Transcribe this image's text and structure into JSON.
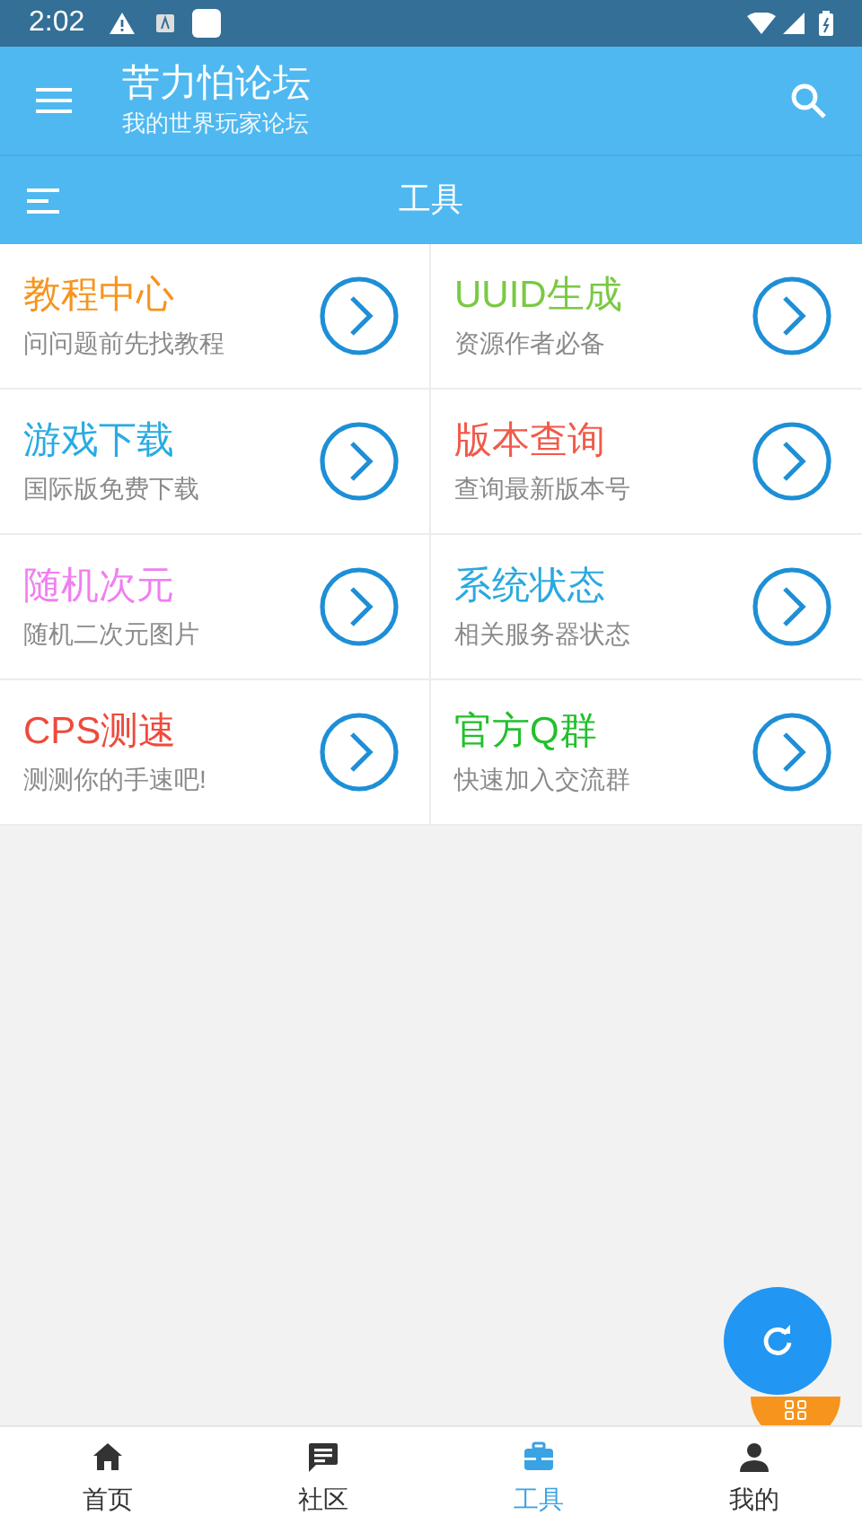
{
  "status_bar": {
    "time": "2:02"
  },
  "app_bar": {
    "title": "苦力怕论坛",
    "subtitle": "我的世界玩家论坛"
  },
  "section_bar": {
    "title": "工具"
  },
  "tools": [
    {
      "title": "教程中心",
      "subtitle": "问问题前先找教程",
      "color": "#f7941d"
    },
    {
      "title": "UUID生成",
      "subtitle": "资源作者必备",
      "color": "#7ac943"
    },
    {
      "title": "游戏下载",
      "subtitle": "国际版免费下载",
      "color": "#29abe2"
    },
    {
      "title": "版本查询",
      "subtitle": "查询最新版本号",
      "color": "#f15a4a"
    },
    {
      "title": "随机次元",
      "subtitle": "随机二次元图片",
      "color": "#f07ff0"
    },
    {
      "title": "系统状态",
      "subtitle": "相关服务器状态",
      "color": "#29a9e0"
    },
    {
      "title": "CPS测速",
      "subtitle": "测测你的手速吧!",
      "color": "#ef4a3c"
    },
    {
      "title": "官方Q群",
      "subtitle": "快速加入交流群",
      "color": "#22c02c"
    }
  ],
  "bottom_nav": [
    {
      "label": "首页",
      "kind": "home",
      "selected": false
    },
    {
      "label": "社区",
      "kind": "chat",
      "selected": false
    },
    {
      "label": "工具",
      "kind": "toolbox",
      "selected": true
    },
    {
      "label": "我的",
      "kind": "person",
      "selected": false
    }
  ]
}
